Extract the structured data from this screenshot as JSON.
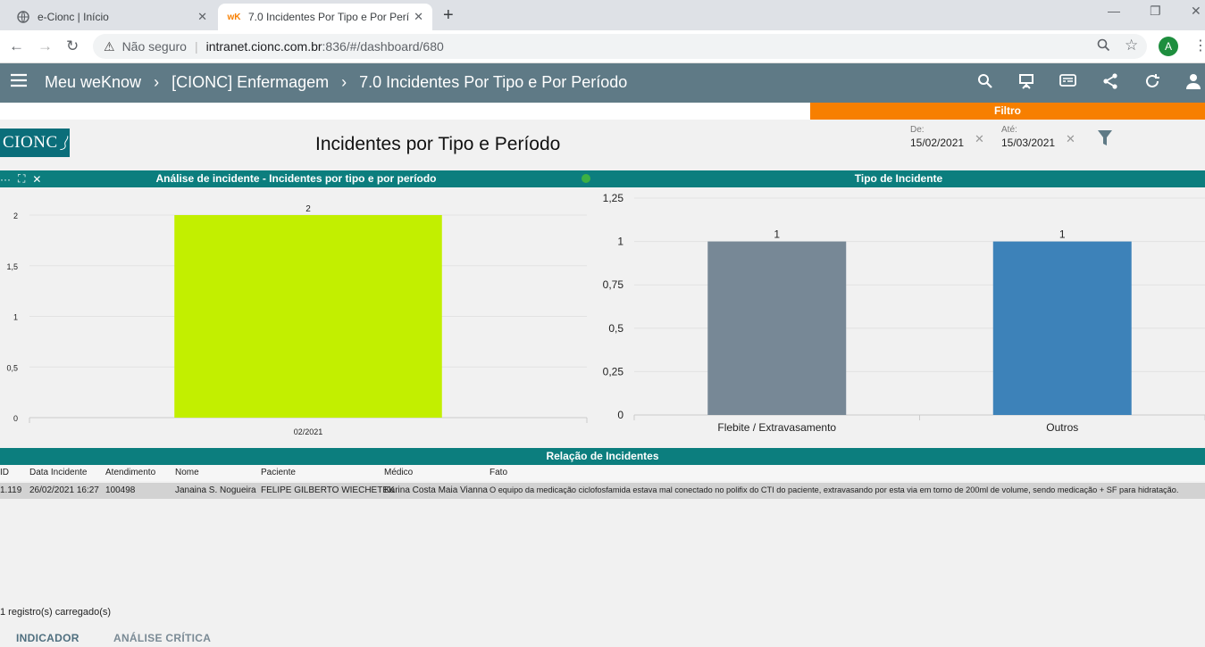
{
  "browser": {
    "tabs": [
      {
        "title": "e-Cionc | Início",
        "favicon": "globe-icon"
      },
      {
        "title": "7.0 Incidentes Por Tipo e Por Perí",
        "favicon": "wK"
      }
    ],
    "security_label": "Não seguro",
    "url_host": "intranet.cionc.com.br",
    "url_rest": ":836/#/dashboard/680",
    "profile_initial": "A"
  },
  "app": {
    "breadcrumbs": [
      "Meu weKnow",
      "[CIONC] Enfermagem",
      "7.0 Incidentes Por Tipo e Por Período"
    ],
    "header_icons": [
      "search-icon",
      "presentation-icon",
      "captions-icon",
      "share-icon",
      "refresh-icon",
      "user-icon"
    ]
  },
  "filter": {
    "label": "Filtro",
    "from_label": "De:",
    "from_value": "15/02/2021",
    "to_label": "Até:",
    "to_value": "15/03/2021"
  },
  "dashboard": {
    "logo_text": "CIONC",
    "title": "Incidentes por Tipo e Período"
  },
  "chart_data": [
    {
      "type": "bar",
      "title": "Análise de incidente - Incidentes por tipo e por período",
      "categories": [
        "02/2021"
      ],
      "values": [
        2
      ],
      "data_labels": [
        "2"
      ],
      "yticks": [
        "0",
        "0,5",
        "1",
        "1,5",
        "2"
      ],
      "ylim": [
        0,
        2
      ],
      "colors": [
        "#c2ef00"
      ],
      "grid": true
    },
    {
      "type": "bar",
      "title": "Tipo de Incidente",
      "categories": [
        "Flebite / Extravasamento",
        "Outros"
      ],
      "values": [
        1,
        1
      ],
      "data_labels": [
        "1",
        "1"
      ],
      "yticks": [
        "0",
        "0,25",
        "0,5",
        "0,75",
        "1",
        "1,25"
      ],
      "ylim": [
        0,
        1.25
      ],
      "colors": [
        "#778896",
        "#3d82b9"
      ],
      "grid": true
    }
  ],
  "table": {
    "title": "Relação de Incidentes",
    "columns": [
      "ID",
      "Data Incidente",
      "Atendimento",
      "Nome",
      "Paciente",
      "Médico",
      "Fato"
    ],
    "rows": [
      [
        "1.119",
        "26/02/2021 16:27",
        "100498",
        "Janaina S. Nogueira",
        "FELIPE GILBERTO WIECHETEK",
        "Karina Costa Maia Vianna",
        "O equipo da medicação ciclofosfamida estava mal conectado no polifix do CTI do paciente, extravasando por esta via em torno de 200ml de volume, sendo medicação + SF para hidratação."
      ]
    ],
    "status": "1 registro(s) carregado(s)"
  },
  "bottom_tabs": [
    "INDICADOR",
    "ANÁLISE CRÍTICA"
  ]
}
